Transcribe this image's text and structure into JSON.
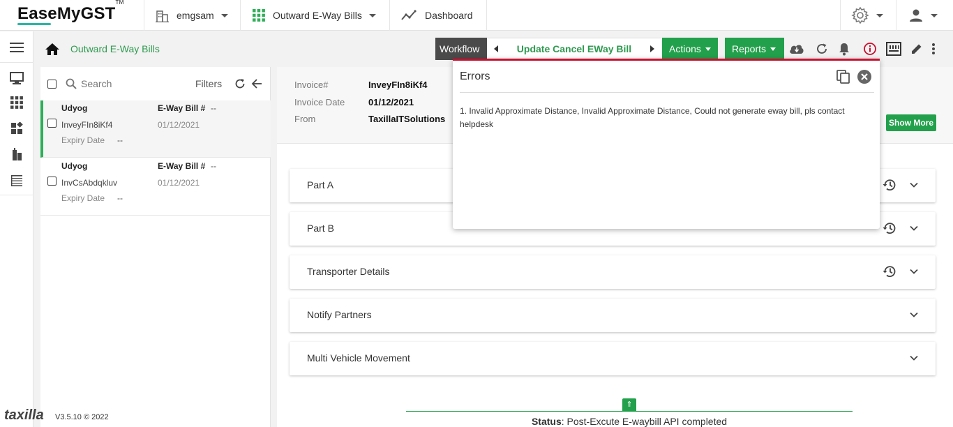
{
  "app": {
    "logo": "EaseMyGST",
    "logo_tm": "TM"
  },
  "topnav": {
    "company": "emgsam",
    "module": "Outward E-Way Bills",
    "dashboard": "Dashboard"
  },
  "breadcrumb": {
    "title": "Outward E-Way Bills"
  },
  "workflow": {
    "label": "Workflow",
    "current": "Update Cancel EWay Bill",
    "actions": "Actions",
    "reports": "Reports"
  },
  "list": {
    "search_placeholder": "Search",
    "filters": "Filters",
    "items": [
      {
        "name": "Udyog",
        "ewb_label": "E-Way Bill #",
        "ewb_value": "--",
        "invoice": "InveyFIn8iKf4",
        "date": "01/12/2021",
        "expiry_label": "Expiry Date",
        "expiry_value": "--"
      },
      {
        "name": "Udyog",
        "ewb_label": "E-Way Bill #",
        "ewb_value": "--",
        "invoice": "InvCsAbdqkluv",
        "date": "01/12/2021",
        "expiry_label": "Expiry Date",
        "expiry_value": "--"
      }
    ]
  },
  "footer": {
    "brand": "taxilla",
    "version": "V3.5.10 © 2022"
  },
  "invoice": {
    "invoice_label": "Invoice#",
    "invoice_value": "InveyFIn8iKf4",
    "date_label": "Invoice Date",
    "date_value": "01/12/2021",
    "from_label": "From",
    "from_value": "TaxillaITSolutions",
    "show_more": "Show More"
  },
  "sections": [
    {
      "label": "Part A"
    },
    {
      "label": "Part B"
    },
    {
      "label": "Transporter Details"
    },
    {
      "label": "Notify Partners"
    },
    {
      "label": "Multi Vehicle Movement"
    }
  ],
  "status": {
    "label": "Status",
    "text": ": Post-Excute E-waybill API completed",
    "tab_icon": "⇑"
  },
  "errors": {
    "title": "Errors",
    "message": "1. Invalid Approximate Distance, Invalid Approximate Distance, Could not generate eway bill, pls contact helpdesk"
  },
  "colors": {
    "brand_green": "#22a04b",
    "error_red": "#c8102e",
    "accent_teal": "#29b6a6"
  }
}
